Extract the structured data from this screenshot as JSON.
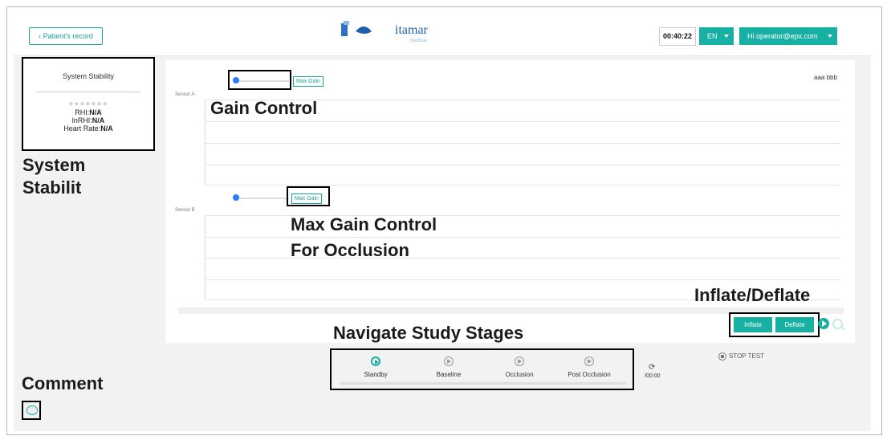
{
  "header": {
    "back_label": "‹ Patient's record",
    "logo_text": "itamar",
    "logo_sub": "medical",
    "timer": "00:40:22",
    "language": "EN",
    "user_label": "Hi operator@epx.com"
  },
  "stability": {
    "title": "System Stability",
    "dots": "●●●●●●●",
    "rhi_label": "RHI:",
    "rhi_value": "N/A",
    "lnrhi_label": "lnRHI:",
    "lnrhi_value": "N/A",
    "hr_label": "Heart Rate:",
    "hr_value": "N/A"
  },
  "sensors": {
    "a_label": "Sensor A",
    "b_label": "Sensor B",
    "max_gain": "Max Gain",
    "corner_text": "aaa bbb"
  },
  "controls": {
    "inflate": "Inflate",
    "deflate": "Deflate"
  },
  "stages": {
    "items": [
      "Standby",
      "Baseline",
      "Occlusion",
      "Post Occlusion"
    ],
    "elapsed": "/00:00",
    "refresh_glyph": "⟳",
    "stop_label": "STOP TEST"
  },
  "annotations": {
    "gain": "Gain Control",
    "system_stab": "System\nStabilit",
    "max_gain": "Max Gain Control\nFor Occlusion",
    "inflate_deflate": "Inflate/Deflate",
    "navigate": "Navigate Study Stages",
    "comment": "Comment"
  },
  "colors": {
    "accent": "#19b0a4",
    "slider_knob": "#2e7df6",
    "logo_blue": "#1f5fae"
  },
  "icons": [
    "play-icon",
    "search-icon",
    "comment-icon",
    "refresh-icon",
    "stop-icon"
  ]
}
